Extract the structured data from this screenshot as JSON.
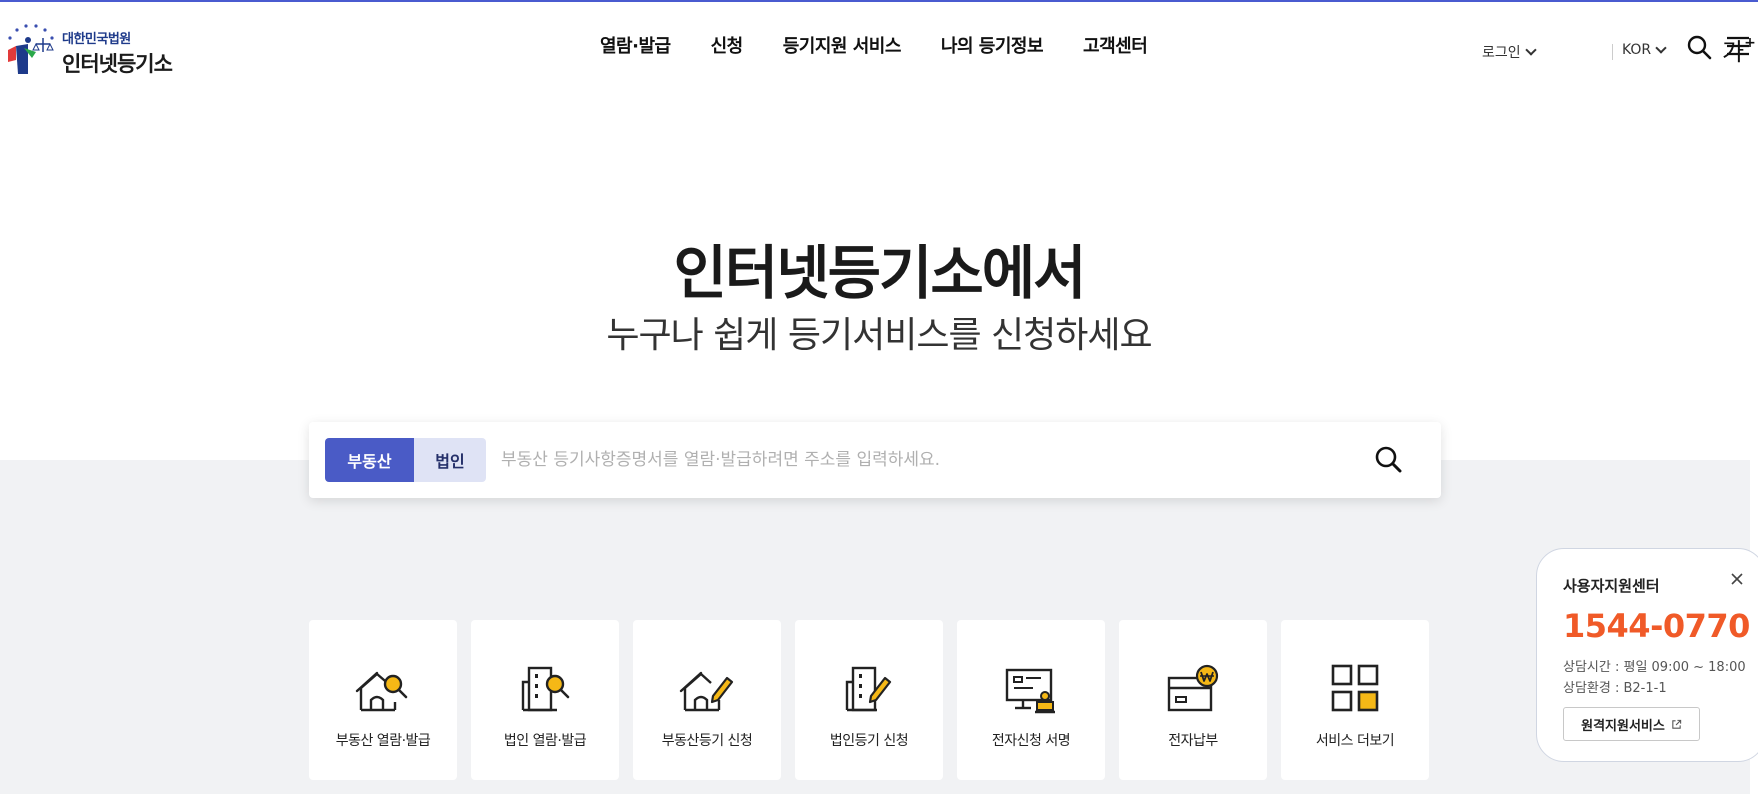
{
  "header": {
    "logo_small": "대한민국법원",
    "logo_big": "인터넷등기소",
    "nav": [
      "열람·발급",
      "신청",
      "등기지원 서비스",
      "나의 등기정보",
      "고객센터"
    ],
    "login_label": "로그인",
    "lang_label": "KOR",
    "font_size_label": "가",
    "font_size_sup": "+"
  },
  "hero": {
    "title": "인터넷등기소에서",
    "subtitle": "누구나 쉽게 등기서비스를 신청하세요"
  },
  "search": {
    "tabs": [
      "부동산",
      "법인"
    ],
    "active_tab": "부동산",
    "placeholder": "부동산 등기사항증명서를 열람·발급하려면 주소를 입력하세요."
  },
  "services": [
    {
      "label": "부동산 열람·발급",
      "icon": "house-search-icon"
    },
    {
      "label": "법인 열람·발급",
      "icon": "building-search-icon"
    },
    {
      "label": "부동산등기 신청",
      "icon": "house-pen-icon"
    },
    {
      "label": "법인등기 신청",
      "icon": "building-pen-icon"
    },
    {
      "label": "전자신청 서명",
      "icon": "monitor-stamp-icon"
    },
    {
      "label": "전자납부",
      "icon": "card-won-icon"
    },
    {
      "label": "서비스 더보기",
      "icon": "grid-more-icon"
    }
  ],
  "support": {
    "title": "사용자지원센터",
    "phone": "1544-0770",
    "hours": "상담시간 : 평일 09:00 ~ 18:00",
    "env": "상담환경 : B2-1-1",
    "remote_label": "원격지원서비스"
  },
  "colors": {
    "accent": "#4a5bc6",
    "accent_light": "#dfe3f5",
    "highlight": "#f5b816",
    "phone": "#f05a28",
    "band": "#f1f2f4"
  }
}
